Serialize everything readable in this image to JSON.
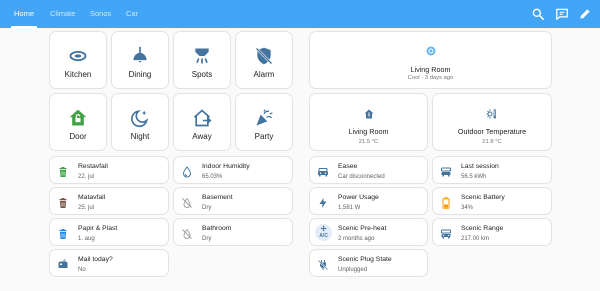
{
  "colors": {
    "header": "#42a5f5",
    "icon_blue": "#44739e",
    "icon_green": "#43a047",
    "icon_brown": "#795548",
    "icon_red": "#e53935",
    "icon_orange": "#ff9800",
    "icon_grey": "#9e9e9e",
    "icon_lightblue": "#64b5f6"
  },
  "header": {
    "tabs": [
      {
        "label": "Home",
        "active": true
      },
      {
        "label": "Climate",
        "active": false
      },
      {
        "label": "Sonos",
        "active": false
      },
      {
        "label": "Car",
        "active": false
      }
    ],
    "actions": [
      "search-icon",
      "assist-icon",
      "edit-icon"
    ]
  },
  "buttons": [
    {
      "label": "Kitchen",
      "icon": "ceiling-light-icon"
    },
    {
      "label": "Dining",
      "icon": "pendant-lamp-icon"
    },
    {
      "label": "Spots",
      "icon": "spotlight-icon"
    },
    {
      "label": "Alarm",
      "icon": "shield-off-icon"
    },
    {
      "label": "Door",
      "icon": "home-lock-open-icon"
    },
    {
      "label": "Night",
      "icon": "weather-night-icon"
    },
    {
      "label": "Away",
      "icon": "home-export-icon"
    },
    {
      "label": "Party",
      "icon": "party-popper-icon"
    }
  ],
  "climate_card": {
    "name": "Living Room",
    "state": "Cool · 3 days ago",
    "icon": "thermostat-icon"
  },
  "sensor_cards": [
    {
      "name": "Living Room",
      "state": "21.5 °C",
      "icon": "home-thermometer-icon"
    },
    {
      "name": "Outdoor Temperature",
      "state": "21.8 °C",
      "icon": "sun-thermometer-icon"
    }
  ],
  "left_entities": [
    {
      "name": "Restavfall",
      "state": "22. jul",
      "icon": "trash-can-icon"
    },
    {
      "name": "Indoor Humidity",
      "state": "65.03%",
      "icon": "water-drop-icon"
    },
    {
      "name": "Matavfall",
      "state": "25. jul",
      "icon": "trash-can-icon"
    },
    {
      "name": "Basement",
      "state": "Dry",
      "icon": "water-off-icon"
    },
    {
      "name": "Papir & Plast",
      "state": "1. aug",
      "icon": "trash-can-icon"
    },
    {
      "name": "Bathroom",
      "state": "Dry",
      "icon": "water-off-icon"
    },
    {
      "name": "Mail today?",
      "state": "No",
      "icon": "mailbox-icon"
    }
  ],
  "right_entities": [
    {
      "name": "Easee",
      "state": "Car disconnected",
      "icon": "car-icon"
    },
    {
      "name": "Last session",
      "state": "56.5 kWh",
      "icon": "ev-station-icon"
    },
    {
      "name": "Power Usage",
      "state": "1,581 W",
      "icon": "lightning-icon"
    },
    {
      "name": "Scenic Battery",
      "state": "34%",
      "icon": "battery-icon"
    },
    {
      "name": "Scenic Pre-heat",
      "state": "2 months ago",
      "icon": "ac-badge-icon",
      "badge_text": "A/C"
    },
    {
      "name": "Scenic Range",
      "state": "217.00 km",
      "icon": "car-range-icon"
    },
    {
      "name": "Scenic Plug State",
      "state": "Unplugged",
      "icon": "power-plug-off-icon"
    }
  ]
}
